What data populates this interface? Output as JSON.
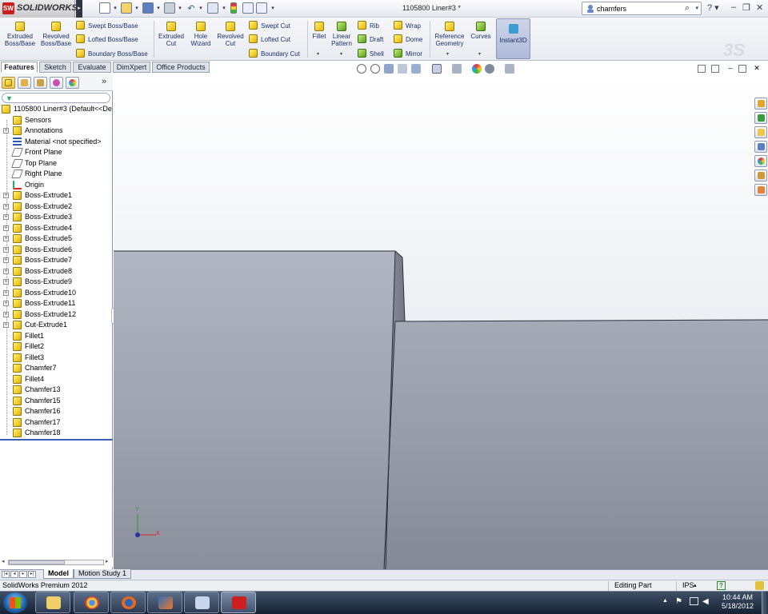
{
  "app": {
    "logo_text": "SOLIDWORKS",
    "logo_badge": "SW",
    "doc_title": "1105800 Liner#3 *"
  },
  "search": {
    "value": "chamfers"
  },
  "ribbon": {
    "extruded_boss": "Extruded Boss/Base",
    "revolved_boss": "Revolved Boss/Base",
    "swept_boss": "Swept Boss/Base",
    "lofted_boss": "Lofted Boss/Base",
    "boundary_boss": "Boundary Boss/Base",
    "extruded_cut": "Extruded Cut",
    "hole_wizard": "Hole Wizard",
    "revolved_cut": "Revolved Cut",
    "swept_cut": "Swept Cut",
    "lofted_cut": "Lofted Cut",
    "boundary_cut": "Boundary Cut",
    "fillet": "Fillet",
    "linear_pattern": "Linear Pattern",
    "rib": "Rib",
    "draft": "Draft",
    "shell": "Shell",
    "wrap": "Wrap",
    "dome": "Dome",
    "mirror": "Mirror",
    "reference_geometry": "Reference Geometry",
    "curves": "Curves",
    "instant3d": "Instant3D"
  },
  "command_tabs": [
    "Features",
    "Sketch",
    "Evaluate",
    "DimXpert",
    "Office Products"
  ],
  "tree": {
    "root": "1105800 Liner#3  (Default<<De",
    "items": [
      {
        "label": "Sensors",
        "icon": "sensor-icon",
        "expand": false
      },
      {
        "label": "Annotations",
        "icon": "annotation-icon",
        "expand": true
      },
      {
        "label": "Material <not specified>",
        "icon": "material-icon",
        "expand": false
      },
      {
        "label": "Front Plane",
        "icon": "plane-icon",
        "expand": false
      },
      {
        "label": "Top Plane",
        "icon": "plane-icon",
        "expand": false
      },
      {
        "label": "Right Plane",
        "icon": "plane-icon",
        "expand": false
      },
      {
        "label": "Origin",
        "icon": "origin-icon",
        "expand": false
      },
      {
        "label": "Boss-Extrude1",
        "icon": "boss-extrude-icon",
        "expand": true
      },
      {
        "label": "Boss-Extrude2",
        "icon": "boss-extrude-icon",
        "expand": true
      },
      {
        "label": "Boss-Extrude3",
        "icon": "boss-extrude-icon",
        "expand": true
      },
      {
        "label": "Boss-Extrude4",
        "icon": "boss-extrude-icon",
        "expand": true
      },
      {
        "label": "Boss-Extrude5",
        "icon": "boss-extrude-icon",
        "expand": true
      },
      {
        "label": "Boss-Extrude6",
        "icon": "boss-extrude-icon",
        "expand": true
      },
      {
        "label": "Boss-Extrude7",
        "icon": "boss-extrude-icon",
        "expand": true
      },
      {
        "label": "Boss-Extrude8",
        "icon": "boss-extrude-icon",
        "expand": true
      },
      {
        "label": "Boss-Extrude9",
        "icon": "boss-extrude-icon",
        "expand": true
      },
      {
        "label": "Boss-Extrude10",
        "icon": "boss-extrude-icon",
        "expand": true
      },
      {
        "label": "Boss-Extrude11",
        "icon": "boss-extrude-icon",
        "expand": true
      },
      {
        "label": "Boss-Extrude12",
        "icon": "boss-extrude-icon",
        "expand": true
      },
      {
        "label": "Cut-Extrude1",
        "icon": "cut-extrude-icon",
        "expand": true
      },
      {
        "label": "Fillet1",
        "icon": "fillet-icon",
        "expand": false
      },
      {
        "label": "Fillet2",
        "icon": "fillet-icon",
        "expand": false
      },
      {
        "label": "Fillet3",
        "icon": "fillet-icon",
        "expand": false
      },
      {
        "label": "Chamfer7",
        "icon": "chamfer-icon",
        "expand": false
      },
      {
        "label": "Fillet4",
        "icon": "fillet-icon",
        "expand": false
      },
      {
        "label": "Chamfer13",
        "icon": "chamfer-icon",
        "expand": false
      },
      {
        "label": "Chamfer15",
        "icon": "chamfer-icon",
        "expand": false
      },
      {
        "label": "Chamfer16",
        "icon": "chamfer-icon",
        "expand": false
      },
      {
        "label": "Chamfer17",
        "icon": "chamfer-icon",
        "expand": false
      },
      {
        "label": "Chamfer18",
        "icon": "chamfer-icon",
        "expand": false
      }
    ]
  },
  "bottom_tabs": [
    "Model",
    "Motion Study 1"
  ],
  "status": {
    "product": "SolidWorks Premium 2012",
    "mode": "Editing Part",
    "units": "IPS",
    "help_glyph": "?"
  },
  "taskbar": {
    "time": "10:44 AM",
    "date": "5/18/2012"
  },
  "triad": {
    "x_label": "X",
    "y_label": "Y"
  },
  "colors": {
    "model_face": "#a9adb8",
    "accent": "#3a5fb3",
    "sw_red": "#cc1f1f"
  }
}
